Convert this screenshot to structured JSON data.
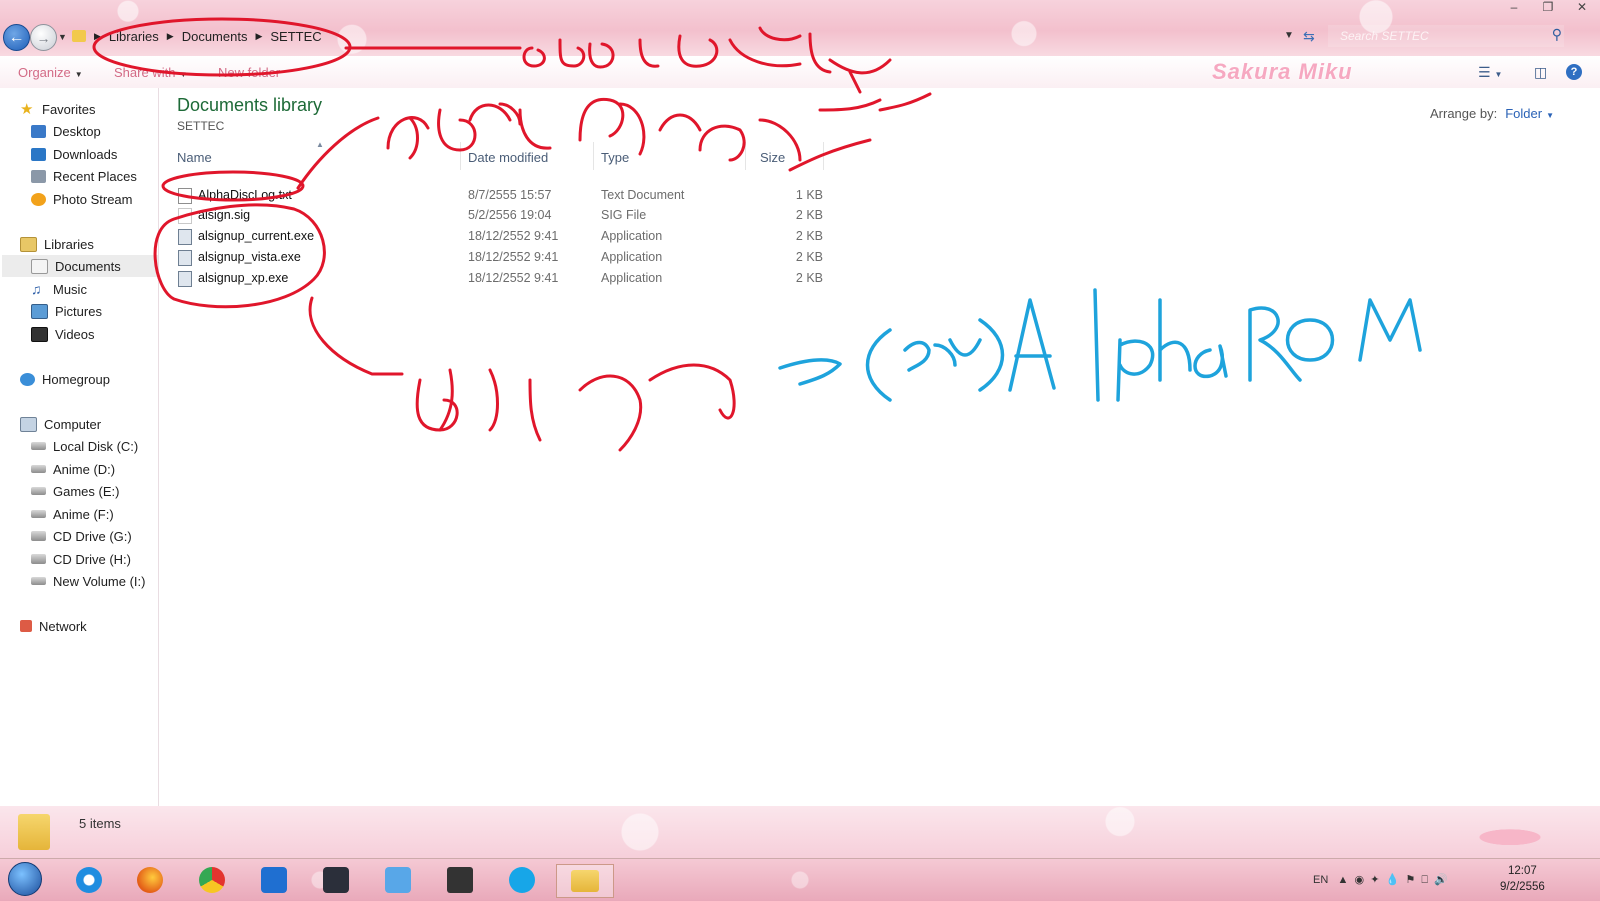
{
  "window": {
    "controls": [
      "–",
      "❐",
      "✕"
    ]
  },
  "breadcrumb": [
    "Libraries",
    "Documents",
    "SETTEC"
  ],
  "search": {
    "placeholder": "Search SETTEC"
  },
  "toolbar": {
    "organize": "Organize",
    "share_with": "Share with",
    "new_folder": "New folder",
    "brand": "Sakura Miku"
  },
  "nav": {
    "favorites": "Favorites",
    "desktop": "Desktop",
    "downloads": "Downloads",
    "recent": "Recent Places",
    "photostream": "Photo Stream",
    "libraries": "Libraries",
    "documents": "Documents",
    "music": "Music",
    "pictures": "Pictures",
    "videos": "Videos",
    "homegroup": "Homegroup",
    "computer": "Computer",
    "drive_c": "Local Disk (C:)",
    "drive_d": "Anime (D:)",
    "drive_e": "Games (E:)",
    "drive_f": "Anime (F:)",
    "drive_g": "CD Drive (G:)",
    "drive_h": "CD Drive (H:)",
    "drive_i": "New Volume (I:)",
    "network": "Network"
  },
  "library": {
    "title": "Documents library",
    "subtitle": "SETTEC",
    "arrange_label": "Arrange by:",
    "arrange_value": "Folder"
  },
  "columns": {
    "name": "Name",
    "date": "Date modified",
    "type": "Type",
    "size": "Size"
  },
  "files": [
    {
      "name": "AlphaDiscLog.txt",
      "date": "8/7/2555 15:57",
      "type": "Text Document",
      "size": "1 KB"
    },
    {
      "name": "alsign.sig",
      "date": "5/2/2556 19:04",
      "type": "SIG File",
      "size": "2 KB"
    },
    {
      "name": "alsignup_current.exe",
      "date": "18/12/2552 9:41",
      "type": "Application",
      "size": "2 KB"
    },
    {
      "name": "alsignup_vista.exe",
      "date": "18/12/2552 9:41",
      "type": "Application",
      "size": "2 KB"
    },
    {
      "name": "alsignup_xp.exe",
      "date": "18/12/2552 9:41",
      "type": "Application",
      "size": "2 KB"
    }
  ],
  "status": {
    "items": "5 items"
  },
  "taskbar": {
    "lang": "EN",
    "time": "12:07",
    "date": "9/2/2556"
  },
  "annotations": {
    "handwriting_blue": "(ใน)AlphaROM",
    "stroke_colors": {
      "red": "#e0162b",
      "blue": "#1ea3dc"
    }
  }
}
